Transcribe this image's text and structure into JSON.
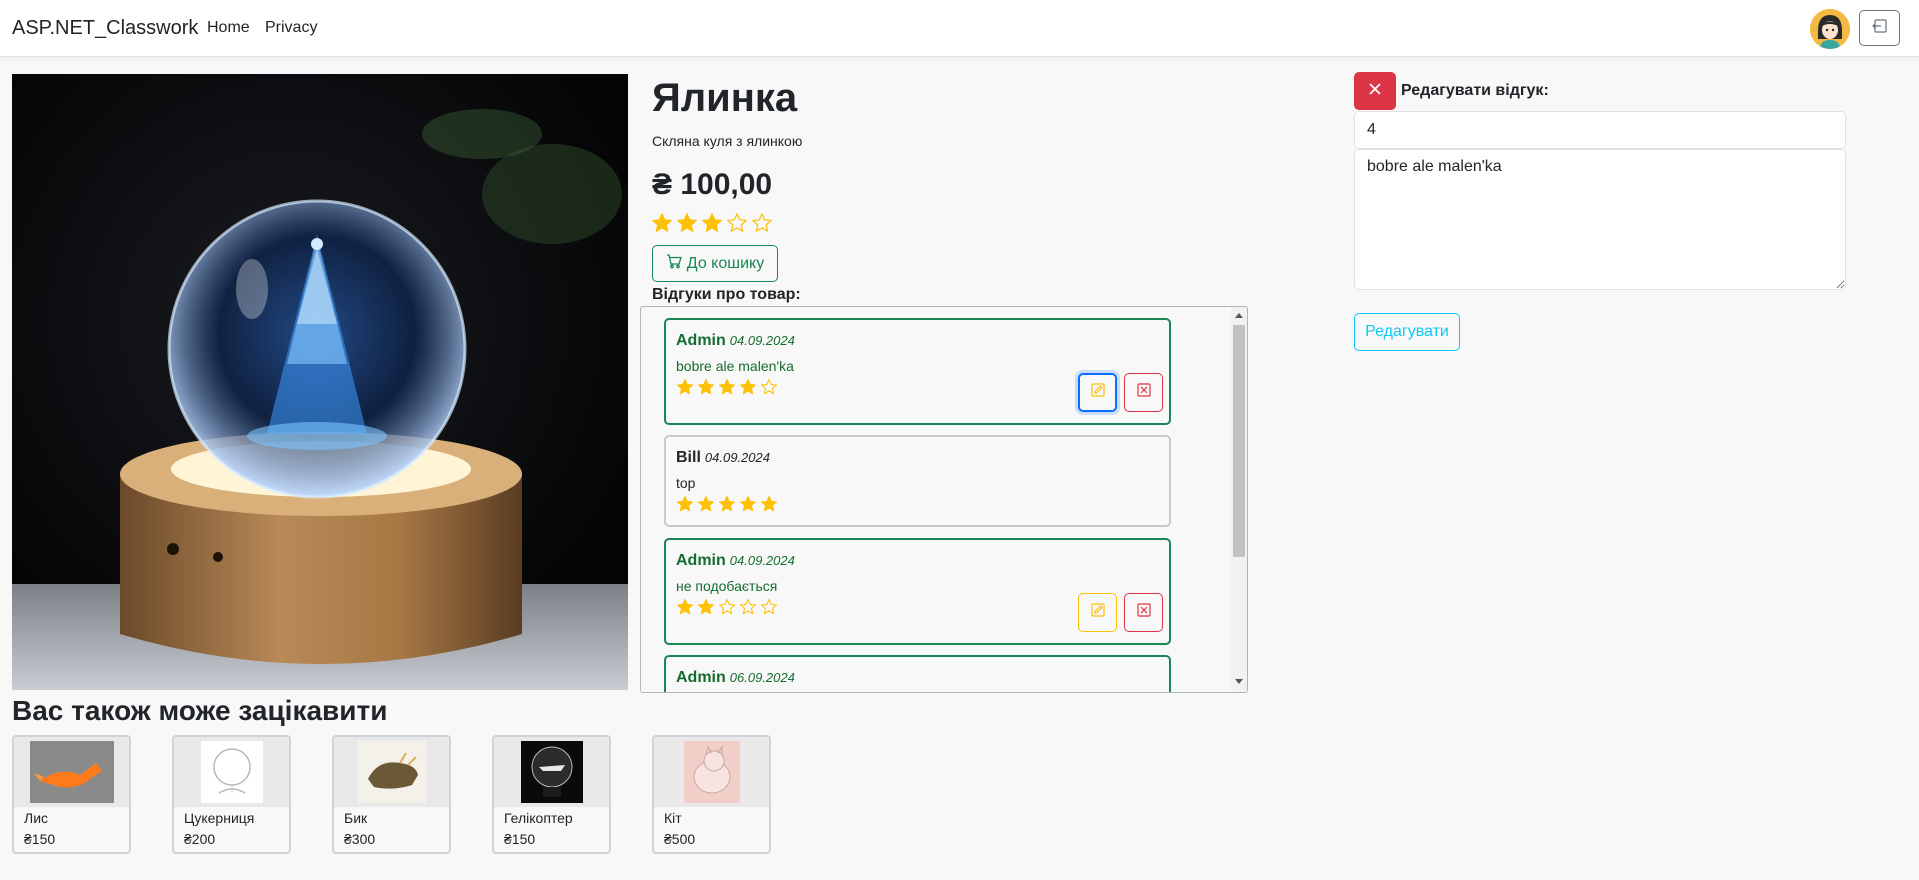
{
  "nav": {
    "brand": "ASP.NET_Classwork",
    "links": [
      "Home",
      "Privacy"
    ]
  },
  "product": {
    "title": "Ялинка",
    "description": "Скляна куля з ялинкою",
    "price": "₴ 100,00",
    "rating": 3,
    "cart_label": "До кошику",
    "reviews_heading": "Відгуки про товар:"
  },
  "reviews": [
    {
      "author": "Admin",
      "date": "04.09.2024",
      "text": "bobre ale malen'ka",
      "rating": 4,
      "own": true
    },
    {
      "author": "Bill",
      "date": "04.09.2024",
      "text": "top",
      "rating": 5,
      "own": false
    },
    {
      "author": "Admin",
      "date": "04.09.2024",
      "text": "не подобається",
      "rating": 2,
      "own": true
    },
    {
      "author": "Admin",
      "date": "06.09.2024",
      "text": "",
      "rating": 0,
      "own": true
    }
  ],
  "edit_panel": {
    "label": "Редагувати відгук:",
    "rating_value": "4",
    "text_value": "bobre ale malen'ka",
    "submit_label": "Редагувати"
  },
  "related": {
    "heading": "Вас також може зацікавити",
    "items": [
      {
        "name": "Лис",
        "price": "₴150"
      },
      {
        "name": "Цукерниця",
        "price": "₴200"
      },
      {
        "name": "Бик",
        "price": "₴300"
      },
      {
        "name": "Гелікоптер",
        "price": "₴150"
      },
      {
        "name": "Кіт",
        "price": "₴500"
      }
    ]
  },
  "colors": {
    "success": "#198754",
    "danger": "#dc3545",
    "warning": "#ffc107",
    "info": "#0dcaf0",
    "star": "#ffc107"
  },
  "icons": [
    "cart-icon",
    "logout-icon",
    "star-icon",
    "edit-icon",
    "delete-icon",
    "close-icon"
  ]
}
